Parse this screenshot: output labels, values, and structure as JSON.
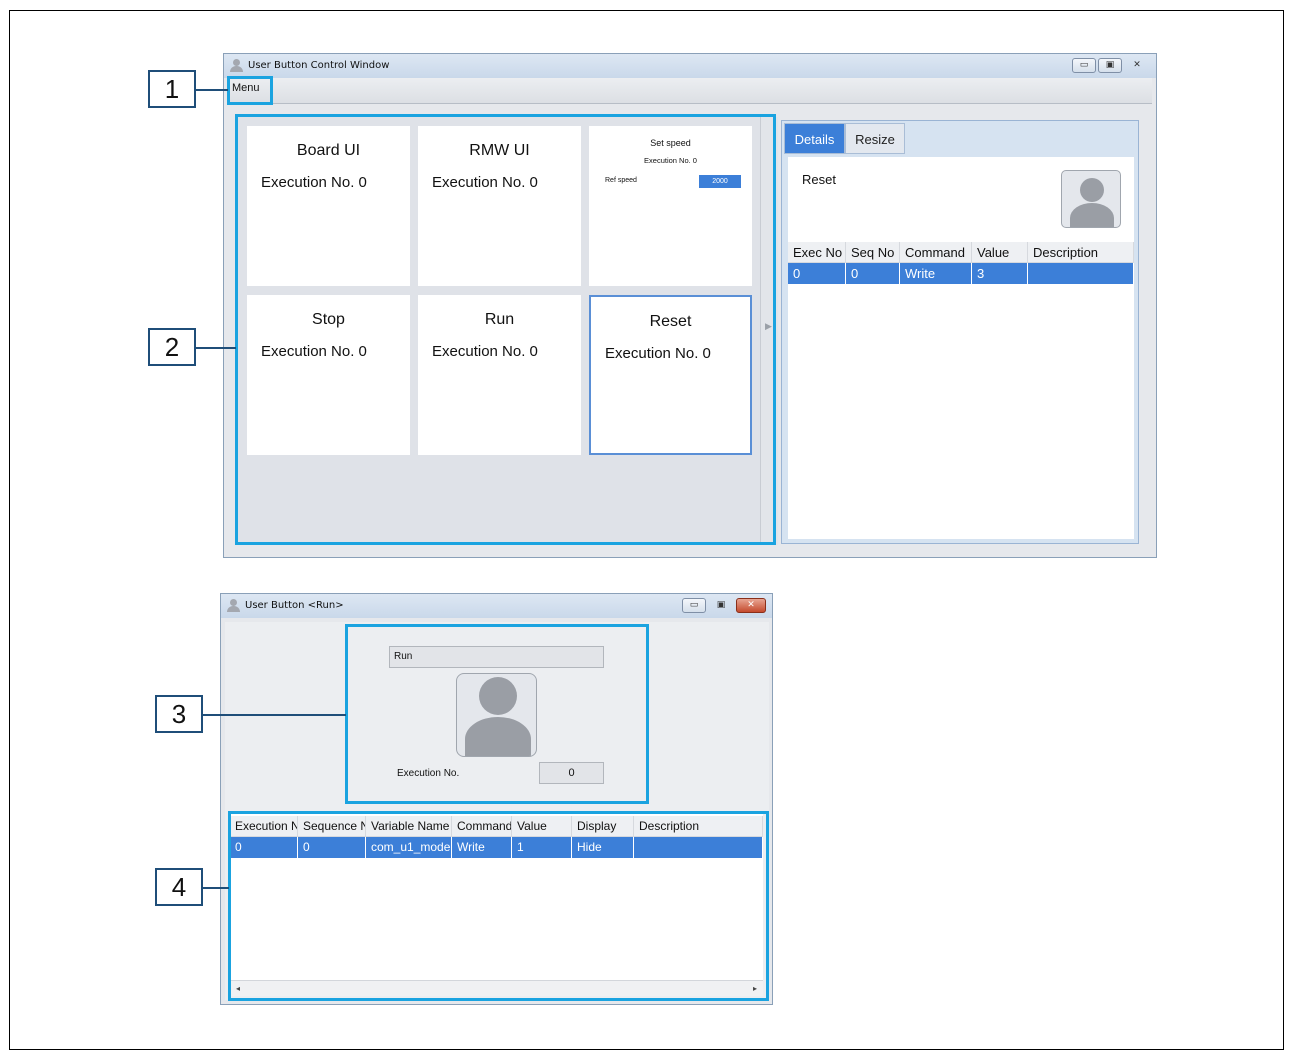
{
  "callouts": [
    "1",
    "2",
    "3",
    "4"
  ],
  "main_window": {
    "title": "User Button Control Window",
    "window_buttons": [
      "▭",
      "▣",
      "✕"
    ],
    "menu": "Menu",
    "cards": [
      {
        "title": "Board UI",
        "exec": "Execution No.  0"
      },
      {
        "title": "RMW UI",
        "exec": "Execution No.  0"
      },
      {
        "title": "Set speed",
        "exec": "Execution No.  0",
        "ref_label": "Ref speed",
        "ref_value": "2000"
      },
      {
        "title": "Stop",
        "exec": "Execution No.  0"
      },
      {
        "title": "Run",
        "exec": "Execution No.  0"
      },
      {
        "title": "Reset",
        "exec": "Execution No.  0"
      }
    ],
    "tabs": [
      "Details",
      "Resize"
    ],
    "detail_name": "Reset",
    "detail_table": {
      "headers": [
        "Exec No",
        "Seq No",
        "Command",
        "Value",
        "Description"
      ],
      "rows": [
        [
          "0",
          "0",
          "Write",
          "3",
          ""
        ]
      ]
    }
  },
  "run_window": {
    "title": "User Button <Run>",
    "window_buttons": [
      "▭",
      "▣",
      "✕"
    ],
    "name": "Run",
    "exec_label": "Execution No.",
    "exec_value": "0",
    "table": {
      "headers": [
        "Execution N",
        "Sequence N",
        "Variable Name",
        "Command",
        "Value",
        "Display",
        "Description"
      ],
      "rows": [
        [
          "0",
          "0",
          "com_u1_mode",
          "Write",
          "1",
          "Hide",
          ""
        ]
      ]
    },
    "scroll_left": "◂",
    "scroll_right": "▸"
  },
  "colors": {
    "highlight": "#1aa3e0",
    "selection": "#3c7fd8",
    "callout_border": "#1f4e79"
  }
}
